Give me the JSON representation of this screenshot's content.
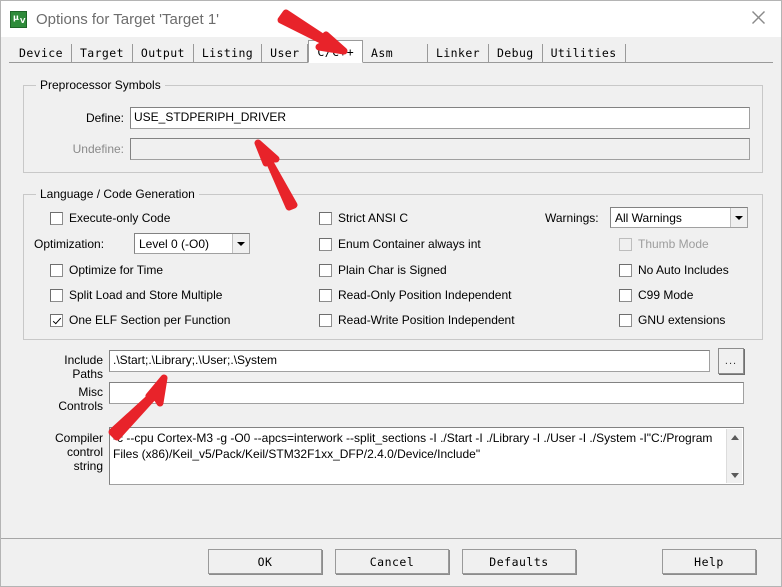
{
  "window": {
    "title": "Options for Target 'Target 1'",
    "icon": "keil-uvision-logo",
    "close_label": "close-icon"
  },
  "tabs": [
    {
      "label": "Device",
      "active": false
    },
    {
      "label": "Target",
      "active": false
    },
    {
      "label": "Output",
      "active": false
    },
    {
      "label": "Listing",
      "active": false
    },
    {
      "label": "User",
      "active": false
    },
    {
      "label": "C/C++",
      "active": true
    },
    {
      "label": "Asm",
      "active": false
    },
    {
      "label": "Linker",
      "active": false
    },
    {
      "label": "Debug",
      "active": false
    },
    {
      "label": "Utilities",
      "active": false
    }
  ],
  "preprocessor": {
    "legend": "Preprocessor Symbols",
    "define_label": "Define:",
    "define_value": "USE_STDPERIPH_DRIVER",
    "undefine_label": "Undefine:",
    "undefine_value": ""
  },
  "language": {
    "legend": "Language / Code Generation",
    "col1": [
      {
        "label": "Execute-only Code",
        "checked": false,
        "disabled": false
      },
      {
        "label": "Optimize for Time",
        "checked": false,
        "disabled": false
      },
      {
        "label": "Split Load and Store Multiple",
        "checked": false,
        "disabled": false
      },
      {
        "label": "One ELF Section per Function",
        "checked": true,
        "disabled": false
      }
    ],
    "optimization_label": "Optimization:",
    "optimization_value": "Level 0 (-O0)",
    "col2": [
      {
        "label": "Strict ANSI C",
        "checked": false,
        "disabled": false
      },
      {
        "label": "Enum Container always int",
        "checked": false,
        "disabled": false
      },
      {
        "label": "Plain Char is Signed",
        "checked": false,
        "disabled": false
      },
      {
        "label": "Read-Only Position Independent",
        "checked": false,
        "disabled": false
      },
      {
        "label": "Read-Write Position Independent",
        "checked": false,
        "disabled": false
      }
    ],
    "warnings_label": "Warnings:",
    "warnings_value": "All Warnings",
    "col3": [
      {
        "label": "Thumb Mode",
        "checked": false,
        "disabled": true
      },
      {
        "label": "No Auto Includes",
        "checked": false,
        "disabled": false
      },
      {
        "label": "C99 Mode",
        "checked": false,
        "disabled": false
      },
      {
        "label": "GNU extensions",
        "checked": false,
        "disabled": false
      }
    ]
  },
  "paths": {
    "include_label_line1": "Include",
    "include_label_line2": "Paths",
    "include_value": ".\\Start;.\\Library;.\\User;.\\System",
    "browse_label": "...",
    "misc_label_line1": "Misc",
    "misc_label_line2": "Controls",
    "misc_value": "",
    "compiler_label_line1": "Compiler",
    "compiler_label_line2": "control",
    "compiler_label_line3": "string",
    "compiler_value": "-c --cpu Cortex-M3 -g -O0 --apcs=interwork --split_sections -I ./Start -I ./Library -I ./User -I ./System -I\"C:/Program Files (x86)/Keil_v5/Pack/Keil/STM32F1xx_DFP/2.4.0/Device/Include\""
  },
  "buttons": {
    "ok": "OK",
    "cancel": "Cancel",
    "defaults": "Defaults",
    "help": "Help"
  },
  "annotations": {
    "arrow_color": "#e8232a",
    "arrow_count": 3
  }
}
